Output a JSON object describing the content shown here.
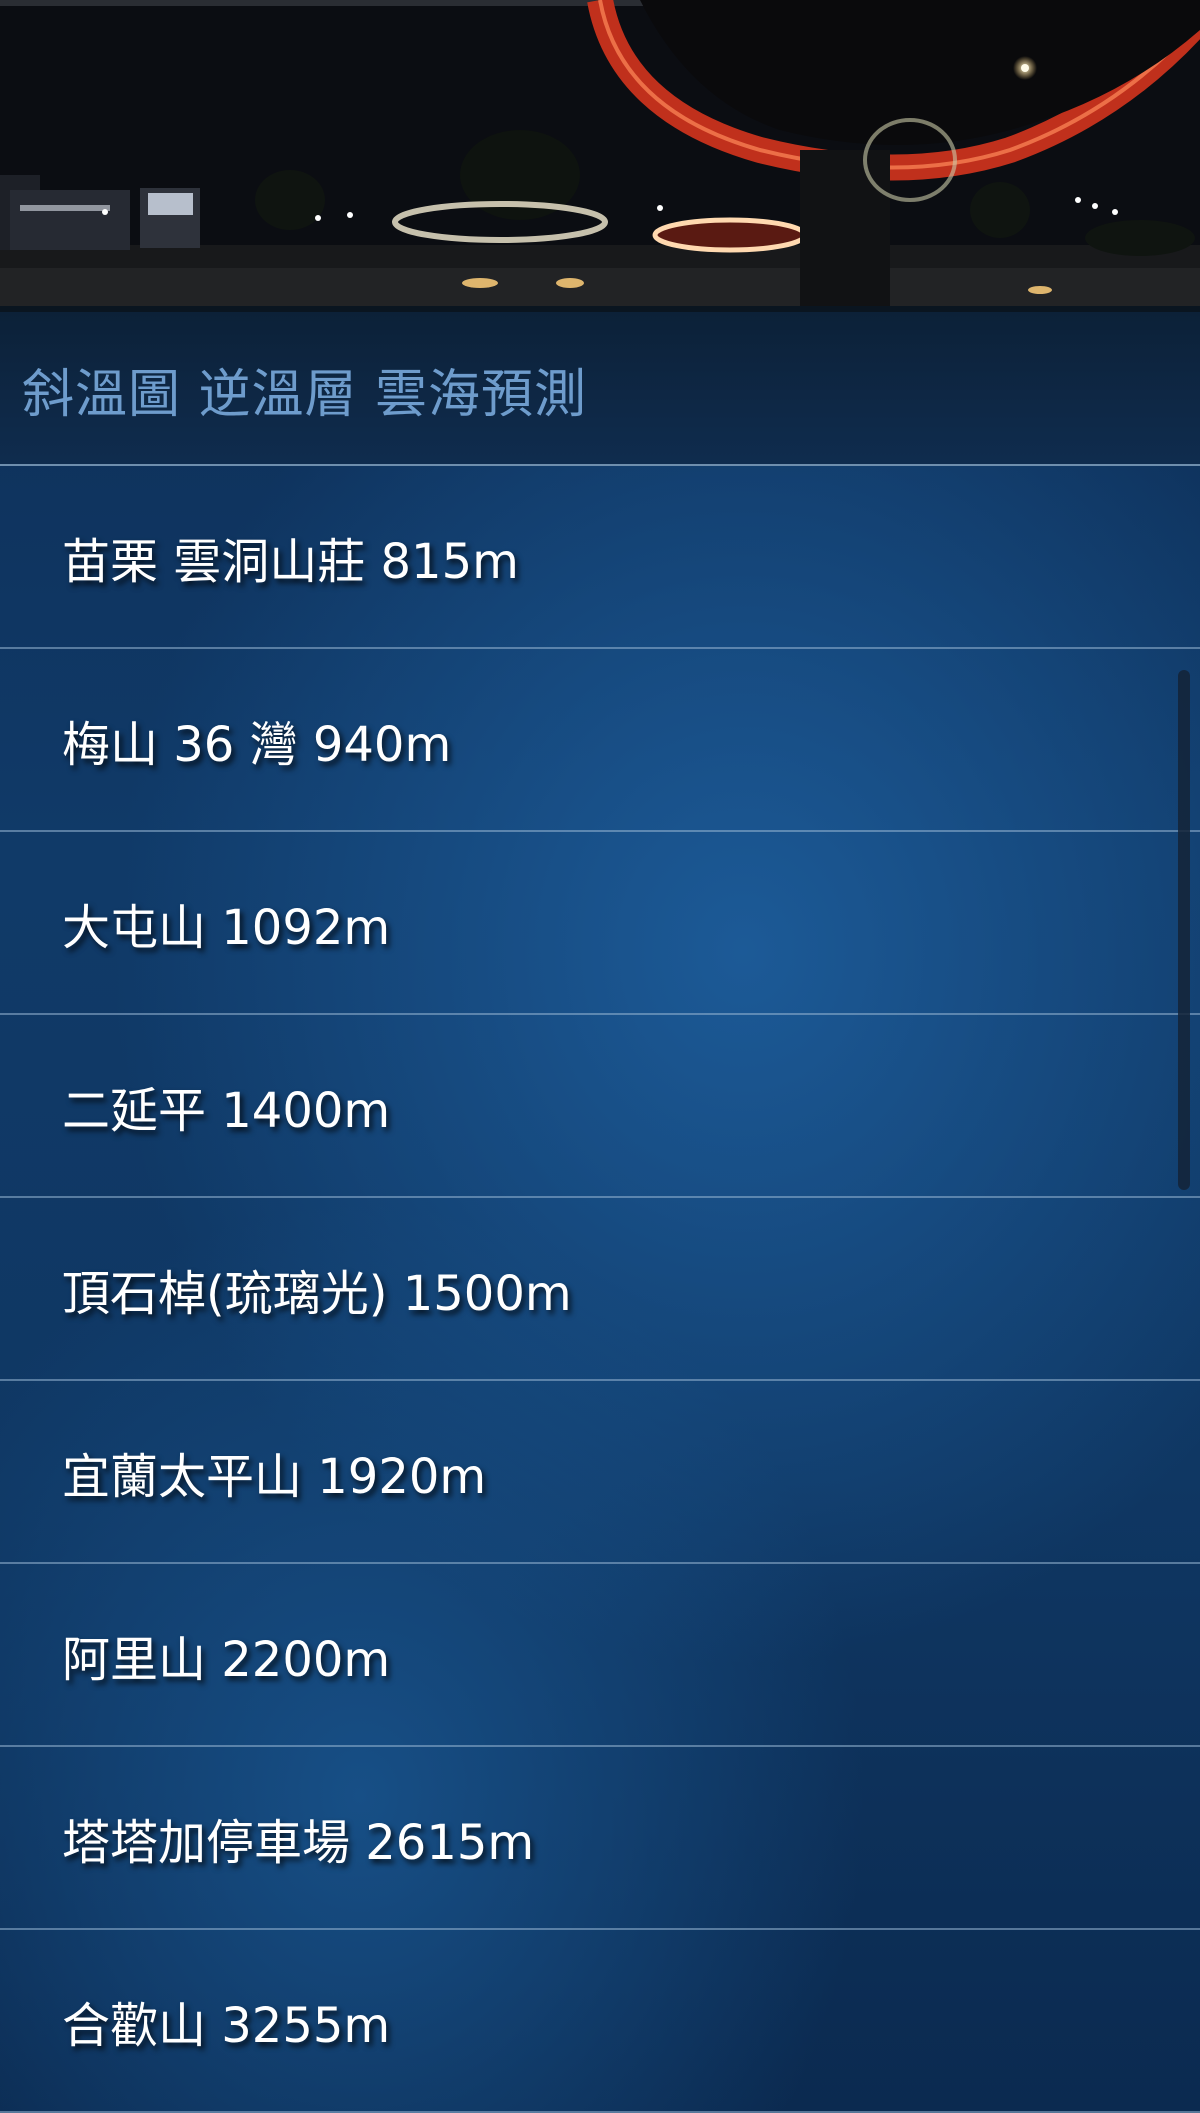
{
  "header": {
    "photo_description_icon": "night-park-bridge-photo"
  },
  "title_bar": {
    "title": "斜溫圖 逆溫層 雲海預測"
  },
  "stations": [
    {
      "label": "苗栗 雲洞山莊 815m"
    },
    {
      "label": "梅山 36 灣 940m"
    },
    {
      "label": "大屯山 1092m"
    },
    {
      "label": "二延平 1400m"
    },
    {
      "label": "頂石棹(琉璃光) 1500m"
    },
    {
      "label": "宜蘭太平山 1920m"
    },
    {
      "label": "阿里山 2200m"
    },
    {
      "label": "塔塔加停車場 2615m"
    },
    {
      "label": "合歡山 3255m"
    }
  ],
  "colors": {
    "title_text": "#6e9ccc",
    "list_text": "#ffffff",
    "background": "#103a68"
  }
}
